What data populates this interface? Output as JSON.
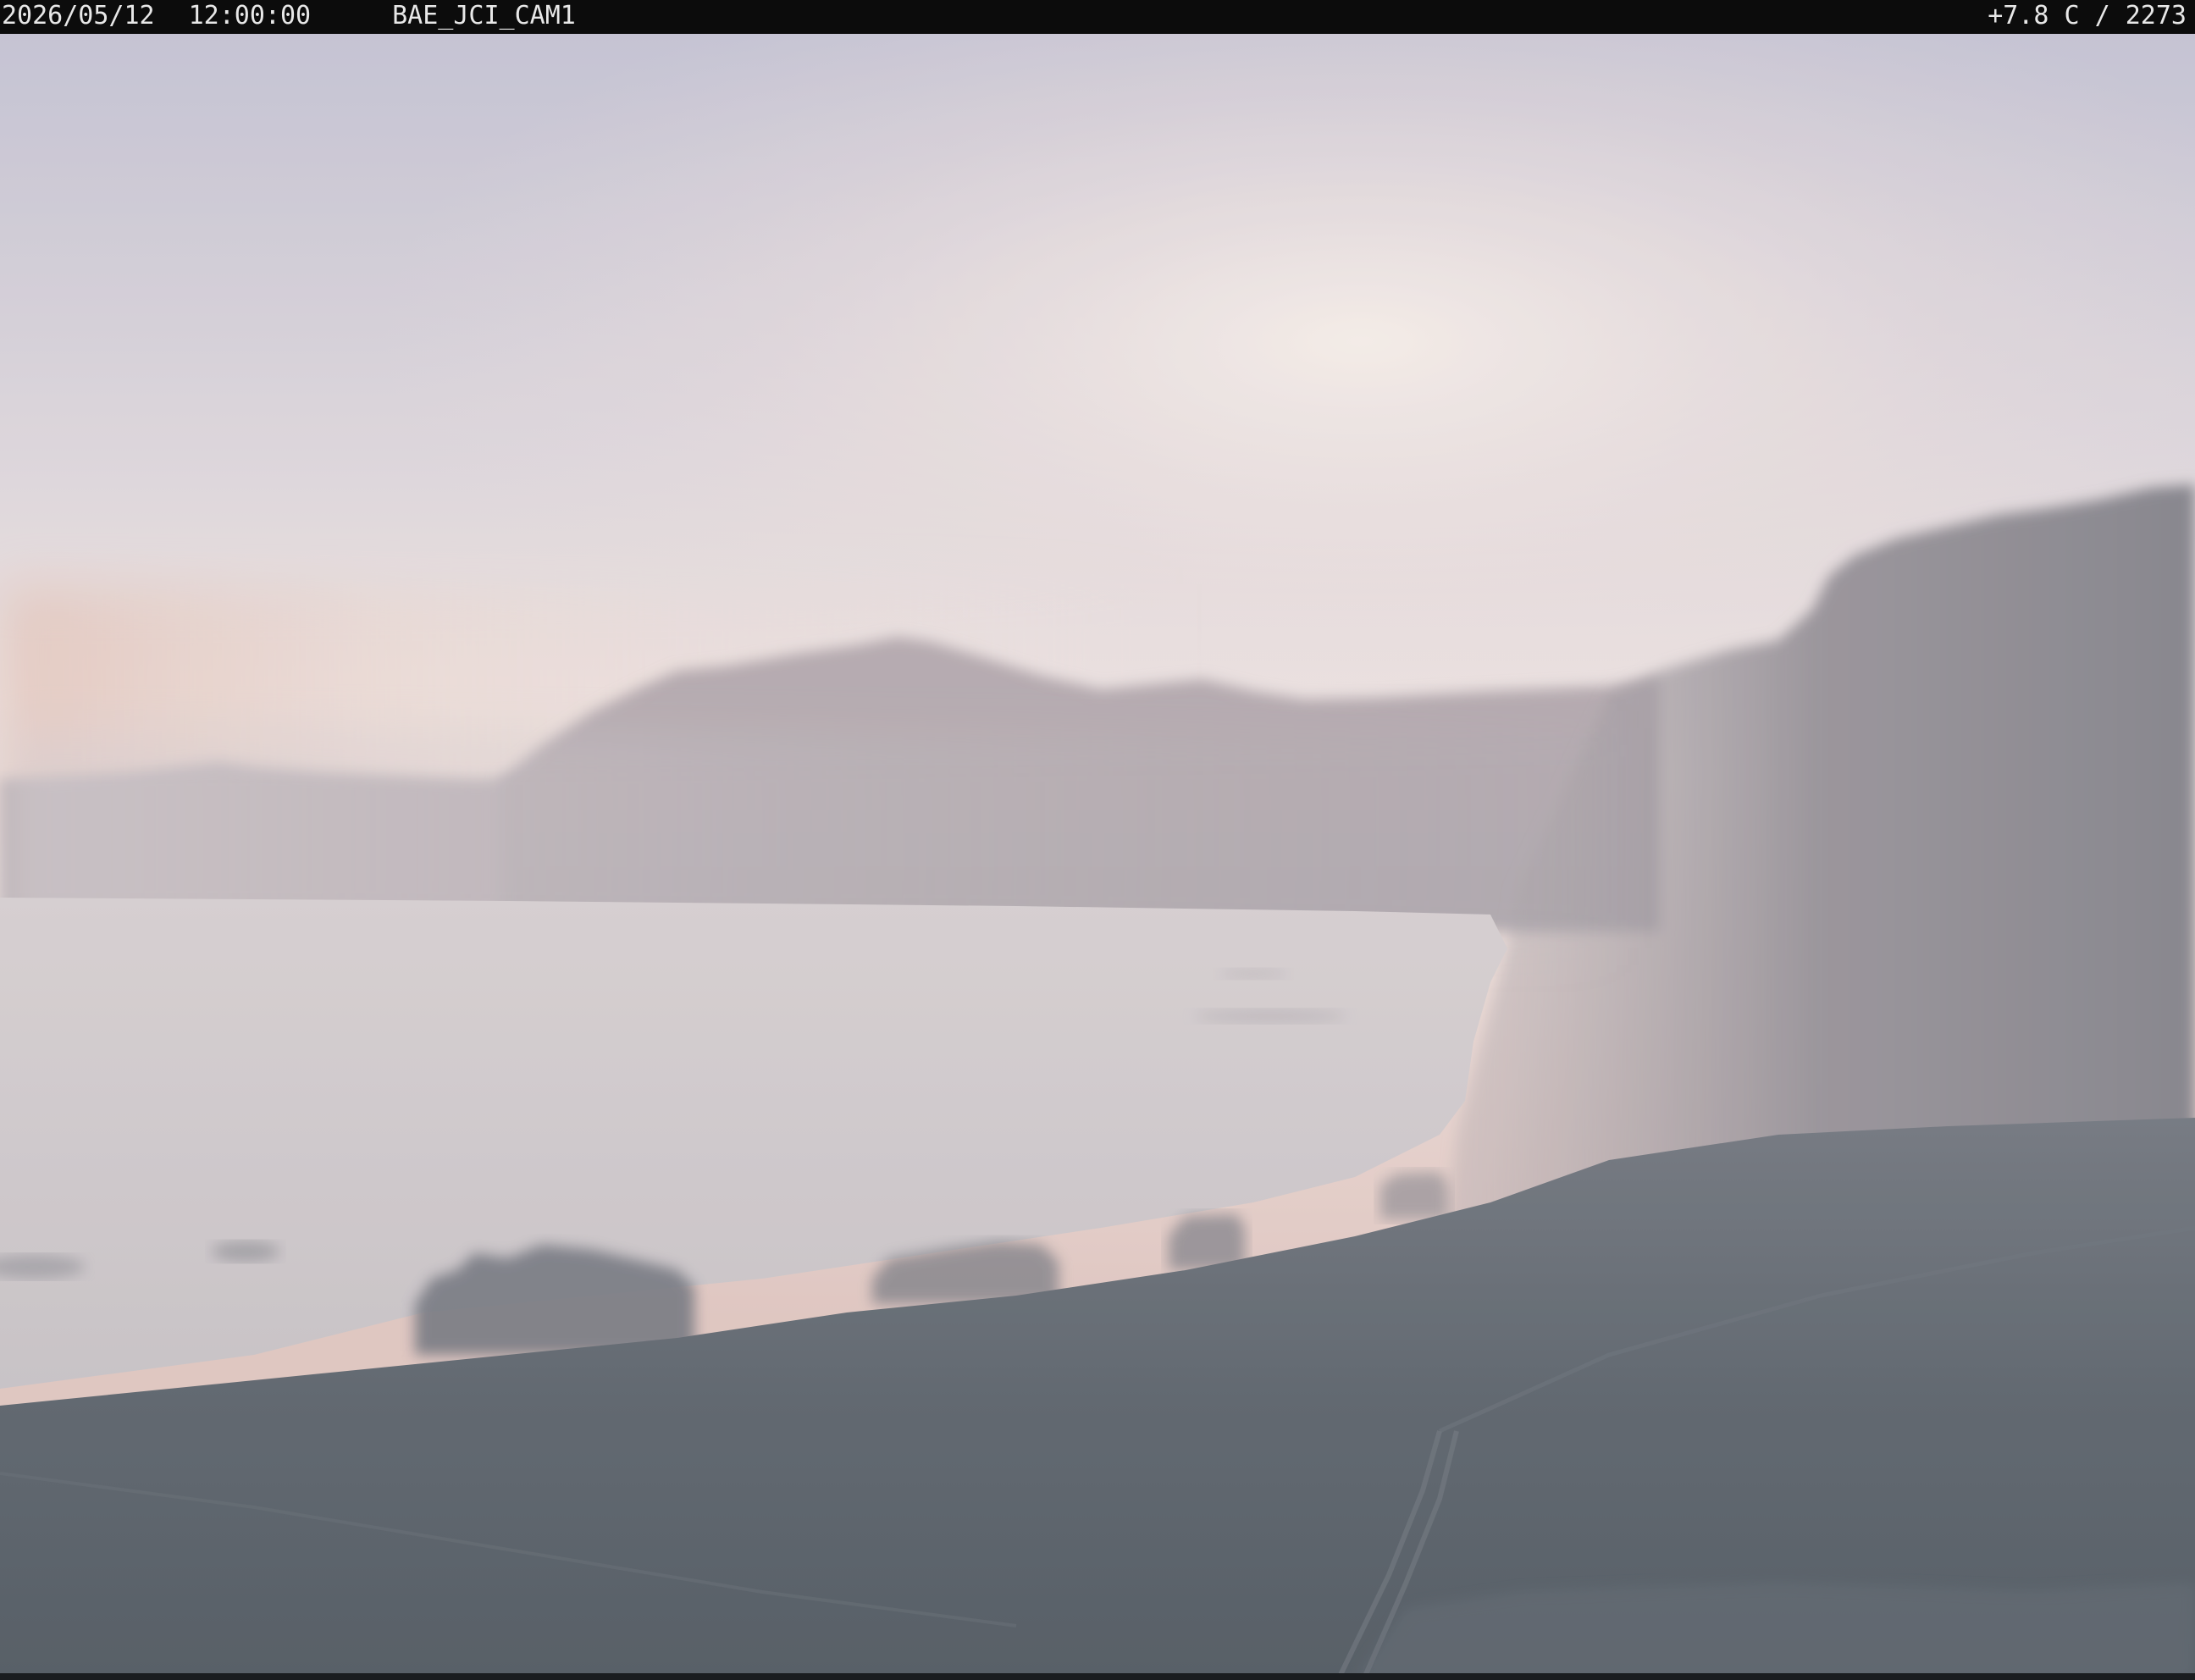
{
  "overlay": {
    "date": "2026/05/12",
    "time": "12:00:00",
    "camera_id": "BAE_JCI_CAM1",
    "readout": "+7.8 C / 2273"
  },
  "scene": {
    "subject": "foggy coastal bay with mountains at dawn",
    "colors": {
      "sky_top": "#c4c2d4",
      "sky_glow": "#f4e8e4",
      "horizon_warm": "#e2c6c0",
      "mountain_far": "#b7abb0",
      "mountain_right": "#8e8a90",
      "water": "#d3cbcd",
      "shore_dark": "#5a6068",
      "foreground": "#48515a"
    }
  }
}
